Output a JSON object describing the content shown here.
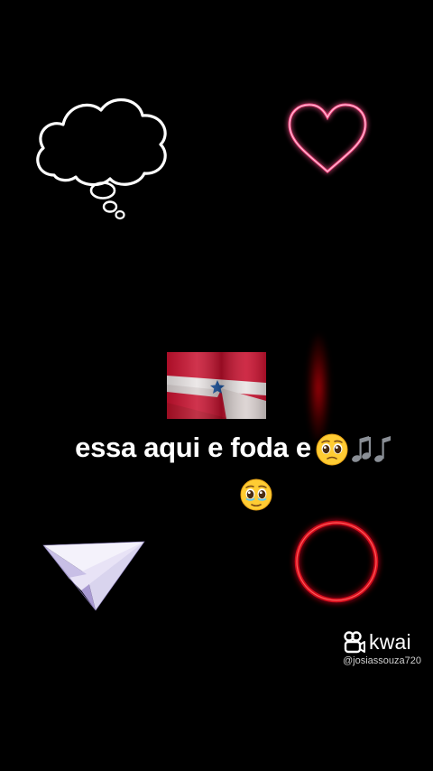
{
  "caption": {
    "line1_text": "essa aqui e foda e",
    "line1_emojis": [
      "pleading-face-emoji",
      "musical-notes-emoji"
    ],
    "line2_emojis": [
      "holding-back-tears-emoji"
    ]
  },
  "stickers": [
    "thought-cloud-icon",
    "neon-heart-icon",
    "para-flag-image",
    "paper-plane-icon",
    "neon-ring-icon"
  ],
  "watermark": {
    "brand": "kwai",
    "handle": "@josiassouza720"
  },
  "colors": {
    "background": "#000000",
    "heart_neon": "#ff4f8a",
    "ring_neon": "#d4101c",
    "flag_red": "#c8102e",
    "flag_star": "#1e5aa8"
  }
}
